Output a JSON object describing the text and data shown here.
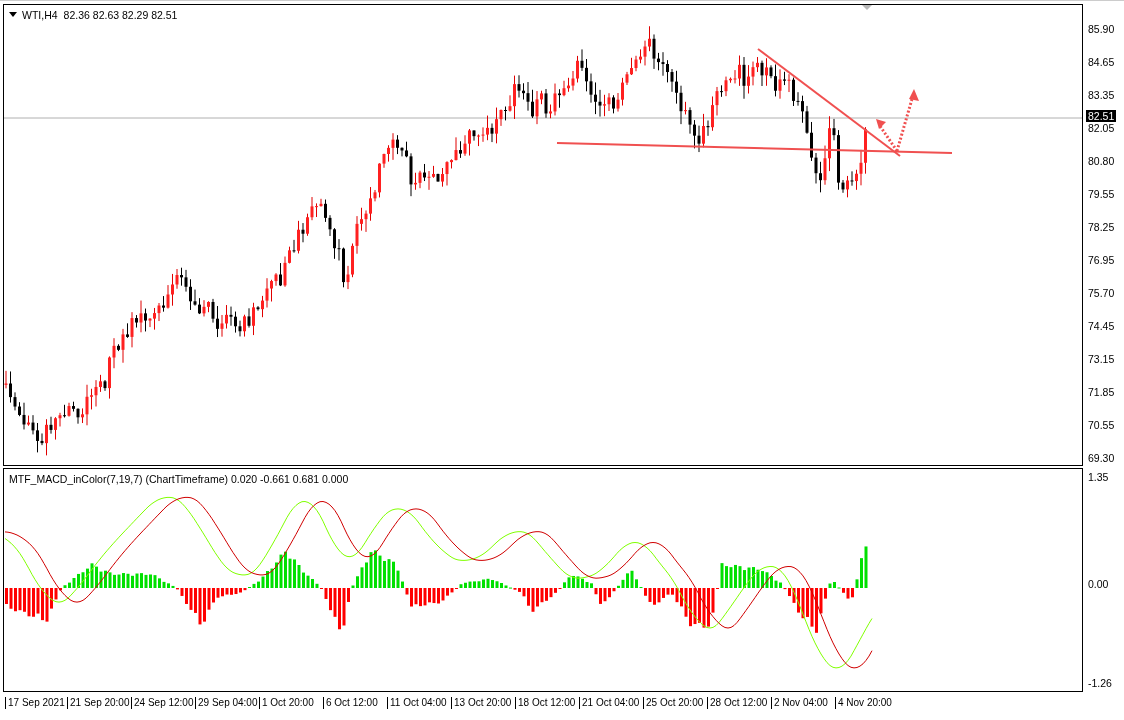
{
  "chart": {
    "symbol": "WTI,H4",
    "ohlc": "82.36 82.63 82.29 82.51",
    "current_price": "82.51",
    "price_axis": [
      "85.90",
      "84.65",
      "83.35",
      "82.05",
      "80.80",
      "79.55",
      "78.25",
      "76.95",
      "75.70",
      "74.45",
      "73.15",
      "71.85",
      "70.55",
      "69.30"
    ]
  },
  "indicator": {
    "title": "MTF_MACD_inColor(7,19,7) (ChartTimeframe) 0.020 -0.661 0.681 0.000",
    "axis": [
      "1.35",
      "0.00",
      "-1.26"
    ]
  },
  "time_axis": [
    "17 Sep 2021",
    "21 Sep 20:00",
    "24 Sep 12:00",
    "29 Sep 04:00",
    "1 Oct 20:00",
    "6 Oct 12:00",
    "11 Oct 04:00",
    "13 Oct 20:00",
    "18 Oct 12:00",
    "21 Oct 04:00",
    "25 Oct 20:00",
    "28 Oct 12:00",
    "2 Nov 04:00",
    "4 Nov 20:00"
  ]
}
